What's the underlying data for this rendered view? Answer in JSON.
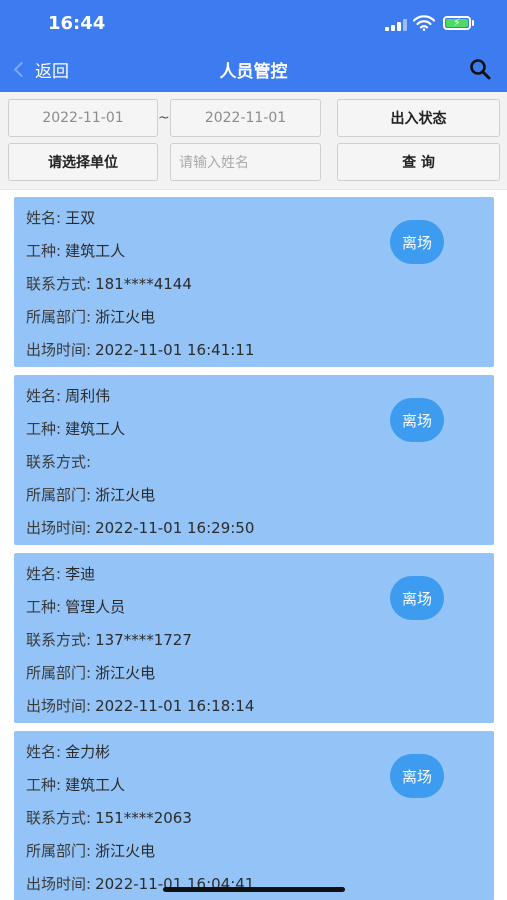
{
  "status_bar": {
    "time": "16:44",
    "battery_color": "#4cd964"
  },
  "nav": {
    "back_label": "返回",
    "title": "人员管控",
    "search_icon": "search-icon"
  },
  "filter": {
    "start_date": "2022-11-01",
    "separator": "~",
    "end_date": "2022-11-01",
    "status_button": "出入状态",
    "unit_button": "请选择单位",
    "name_placeholder": "请输入姓名",
    "query_button": "查 询"
  },
  "labels": {
    "name": "姓名:",
    "job": "工种:",
    "contact": "联系方式:",
    "dept": "所属部门:",
    "time": "出场时间:"
  },
  "records": [
    {
      "name": "王双",
      "job": "建筑工人",
      "contact": "181****4144",
      "dept": "浙江火电",
      "time": "2022-11-01 16:41:11",
      "status": "离场"
    },
    {
      "name": "周利伟",
      "job": "建筑工人",
      "contact": "",
      "dept": "浙江火电",
      "time": "2022-11-01 16:29:50",
      "status": "离场"
    },
    {
      "name": "李迪",
      "job": "管理人员",
      "contact": "137****1727",
      "dept": "浙江火电",
      "time": "2022-11-01 16:18:14",
      "status": "离场"
    },
    {
      "name": "金力彬",
      "job": "建筑工人",
      "contact": "151****2063",
      "dept": "浙江火电",
      "time": "2022-11-01 16:04:41",
      "status": "离场"
    }
  ],
  "colors": {
    "primary": "#3d7bf0",
    "card": "#94c4f7",
    "badge": "#3d9bf0"
  }
}
